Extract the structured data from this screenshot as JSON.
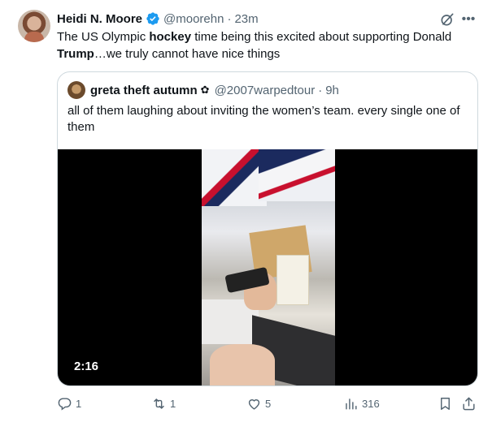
{
  "tweet": {
    "author_name": "Heidi N. Moore",
    "handle": "@moorehn",
    "separator": "·",
    "time": "23m",
    "text_parts": {
      "p1": "The US Olympic ",
      "b1": "hockey",
      "p2": " time being this excited about supporting Donald ",
      "b2": "Trump",
      "p3": "…we truly cannot have nice things"
    }
  },
  "quote": {
    "author_name": "greta theft autumn",
    "handle": "@2007warpedtour",
    "separator": "·",
    "time": "9h",
    "text": "all of them laughing about inviting the women’s team. every single one of them",
    "video": {
      "duration": "2:16"
    }
  },
  "actions": {
    "replies": "1",
    "retweets": "1",
    "likes": "5",
    "views": "316"
  },
  "colors": {
    "verified": "#1d9bf0",
    "secondary_text": "#536471",
    "border": "#cfd9de"
  },
  "icons": [
    "verified-badge-icon",
    "grok-icon",
    "more-icon",
    "flower-icon",
    "reply-icon",
    "retweet-icon",
    "like-icon",
    "views-icon",
    "bookmark-icon",
    "share-icon"
  ]
}
